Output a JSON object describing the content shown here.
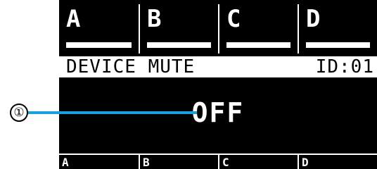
{
  "channels": [
    {
      "label": "A"
    },
    {
      "label": "B"
    },
    {
      "label": "C"
    },
    {
      "label": "D"
    }
  ],
  "screen": {
    "title": "DEVICE MUTE",
    "id": "ID:01",
    "value": "OFF"
  },
  "bottom_channels": [
    {
      "label": "A"
    },
    {
      "label": "B"
    },
    {
      "label": "C"
    },
    {
      "label": "D"
    }
  ],
  "callout": {
    "number": "①",
    "color": "#1aa0dc"
  }
}
